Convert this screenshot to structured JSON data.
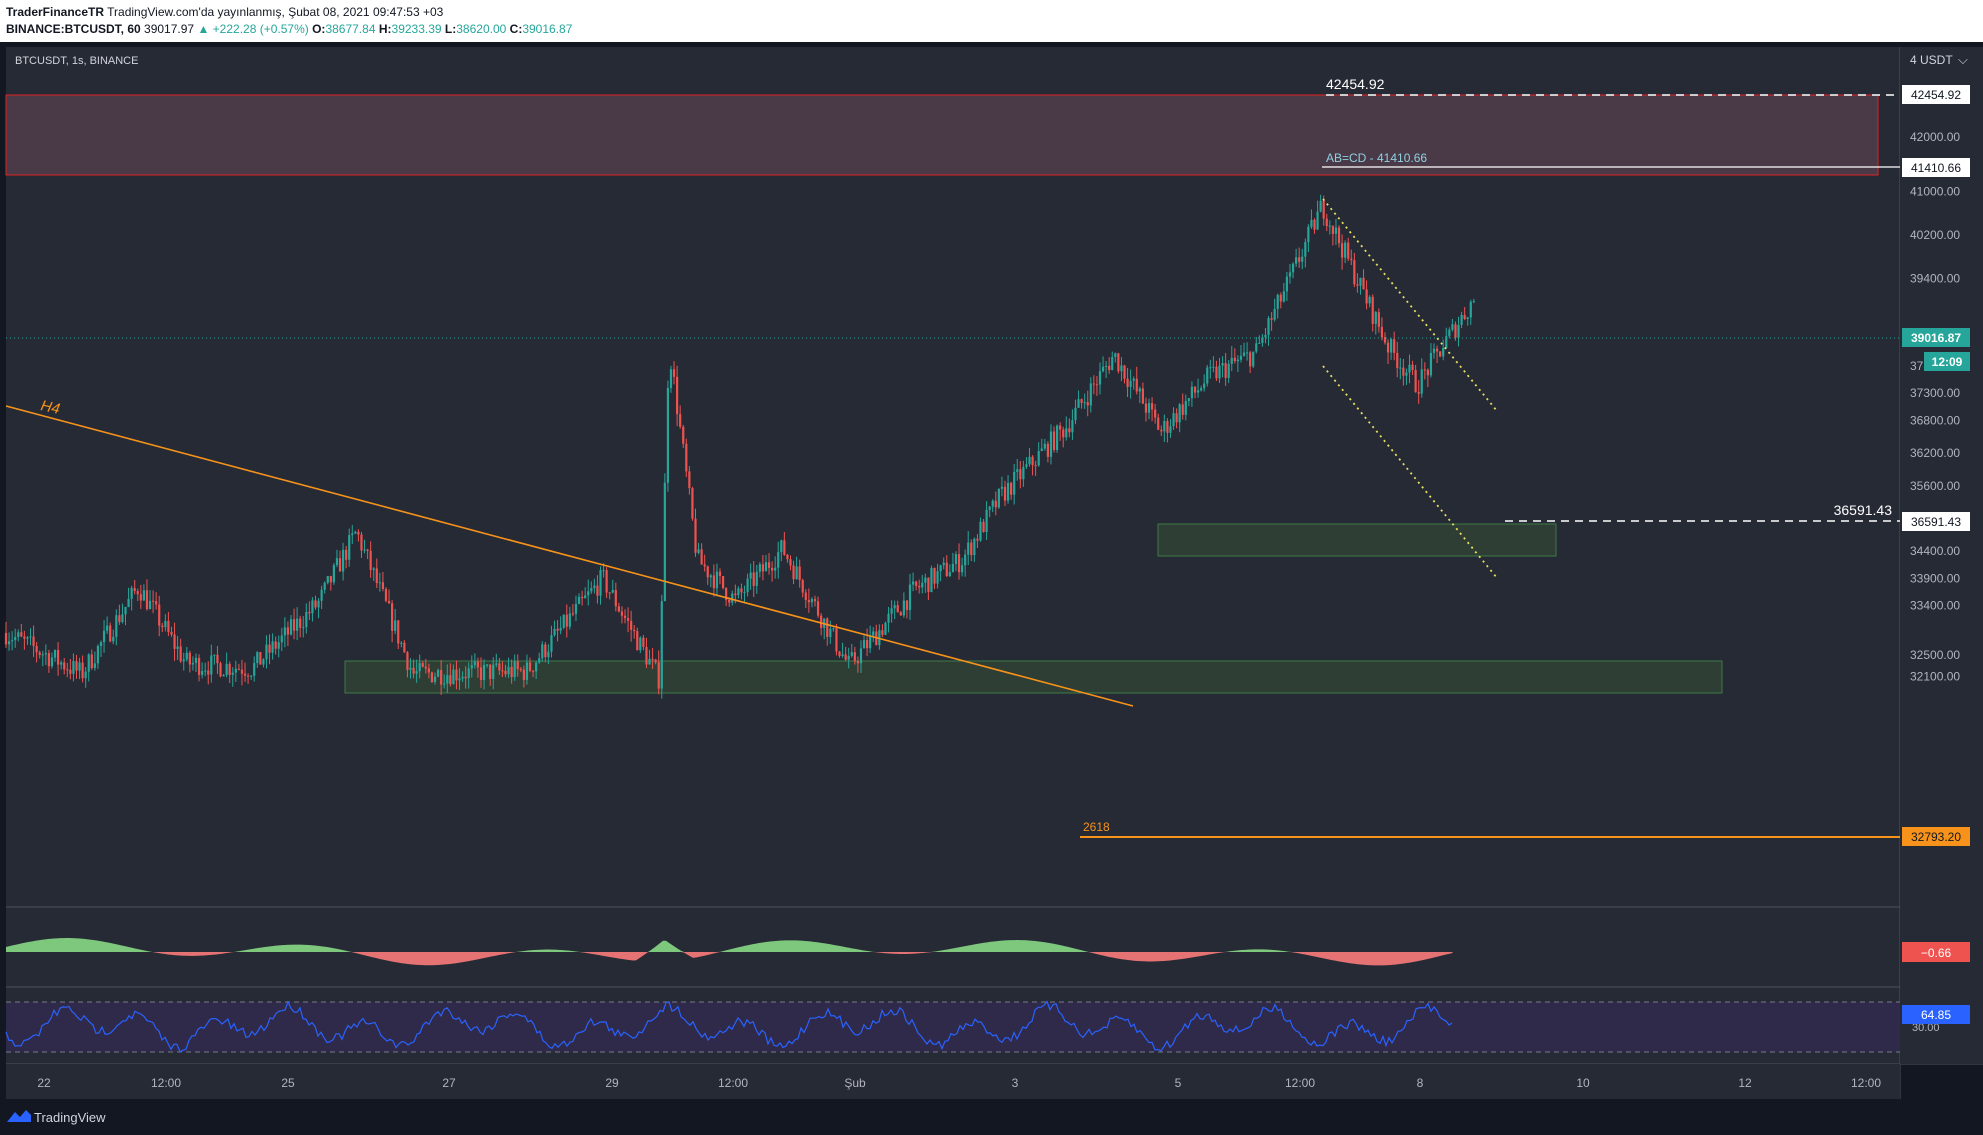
{
  "header": {
    "author": "TraderFinanceTR",
    "published": "TradingView.com'da yayınlanmış, Şubat 08, 2021 09:47:53 +03",
    "symbol": "BINANCE:BTCUSDT, 60",
    "last": "39017.97",
    "change": "+222.28 (+0.57%)",
    "o_label": "O:",
    "o": "38677.84",
    "h_label": "H:",
    "h": "39233.39",
    "l_label": "L:",
    "l": "38620.00",
    "c_label": "C:",
    "c": "39016.87"
  },
  "chart_title": "BTCUSDT, 1s, BINANCE",
  "footer": {
    "brand": "TradingView"
  },
  "chart_data": {
    "type": "candlestick",
    "currency_label": "4 USDT",
    "ylim": [
      31900,
      43700
    ],
    "y_ticks": [
      42000,
      41000,
      40200,
      39400,
      37800,
      37300,
      36800,
      36200,
      35600,
      35000,
      34400,
      33900,
      33400,
      32500,
      32100
    ],
    "x_ticks": [
      "22",
      "12:00",
      "25",
      "27",
      "29",
      "12:00",
      "Şub",
      "3",
      "5",
      "12:00",
      "8",
      "10",
      "12",
      "12:00"
    ],
    "last_price": "39016.87",
    "countdown": "12:09",
    "colors": {
      "up": "#26a69a",
      "down": "#ef5350",
      "level": "#f7931a",
      "background": "#131722"
    },
    "path": [
      [
        0,
        32900
      ],
      [
        0.04,
        32150
      ],
      [
        0.07,
        33750
      ],
      [
        0.095,
        32350
      ],
      [
        0.13,
        32250
      ],
      [
        0.165,
        33450
      ],
      [
        0.185,
        34750
      ],
      [
        0.215,
        32150
      ],
      [
        0.275,
        32200
      ],
      [
        0.315,
        33900
      ],
      [
        0.345,
        32050
      ],
      [
        0.35,
        38200
      ],
      [
        0.365,
        34250
      ],
      [
        0.385,
        33500
      ],
      [
        0.41,
        34450
      ],
      [
        0.445,
        32300
      ],
      [
        0.48,
        33700
      ],
      [
        0.505,
        34250
      ],
      [
        0.525,
        35400
      ],
      [
        0.56,
        36700
      ],
      [
        0.585,
        38000
      ],
      [
        0.61,
        36600
      ],
      [
        0.635,
        37600
      ],
      [
        0.66,
        38050
      ],
      [
        0.68,
        39550
      ],
      [
        0.695,
        40750
      ],
      [
        0.73,
        38150
      ],
      [
        0.745,
        37450
      ],
      [
        0.765,
        38500
      ],
      [
        0.775,
        39020
      ]
    ],
    "annotations": {
      "resistance_price": "42454.92",
      "abcd_label": "AB=CD - 41410.66",
      "abcd_price": "41410.66",
      "support_price": "36591.43",
      "trendline_label": "H4",
      "fib_label": "2618",
      "fib_price": "32793.20"
    },
    "oscillator_value": "−0.66",
    "rsi_value": "64.85",
    "rsi_tick": "30.00"
  }
}
